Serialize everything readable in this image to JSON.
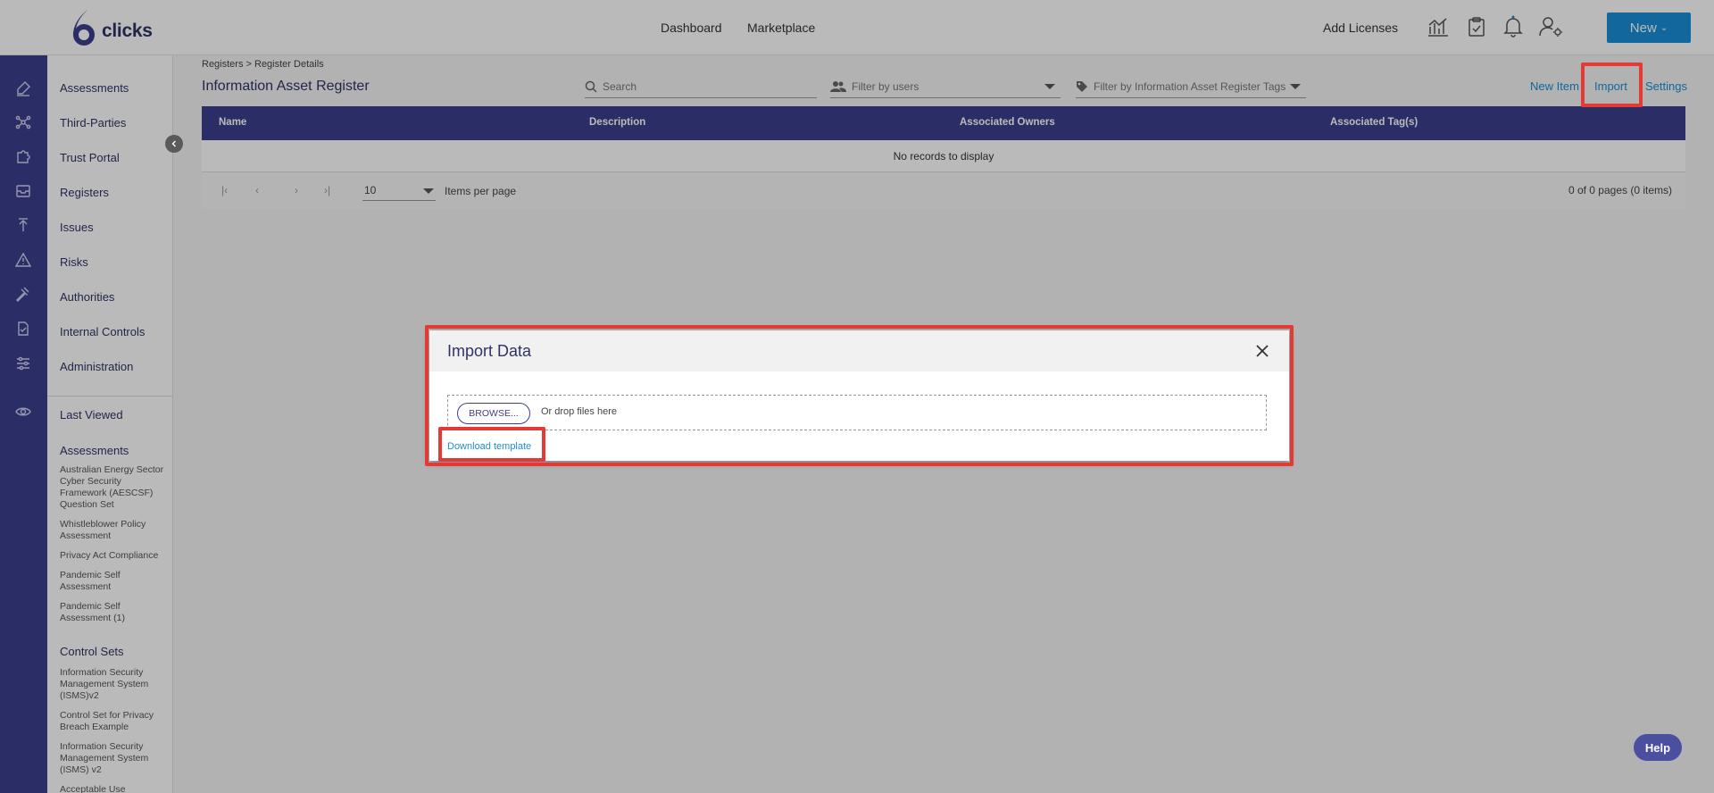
{
  "header": {
    "logo_text": "clicks",
    "nav": {
      "dashboard": "Dashboard",
      "marketplace": "Marketplace"
    },
    "add_licenses": "Add Licenses",
    "new_button": "New",
    "icons": [
      "analytics-icon",
      "clipboard-check-icon",
      "bell-icon",
      "user-settings-icon"
    ]
  },
  "sidebar": {
    "items": [
      {
        "label": "Assessments",
        "icon": "edit-icon"
      },
      {
        "label": "Third-Parties",
        "icon": "network-icon"
      },
      {
        "label": "Trust Portal",
        "icon": "puzzle-icon"
      },
      {
        "label": "Registers",
        "icon": "inbox-icon"
      },
      {
        "label": "Issues",
        "icon": "exit-icon"
      },
      {
        "label": "Risks",
        "icon": "warning-icon"
      },
      {
        "label": "Authorities",
        "icon": "gavel-icon"
      },
      {
        "label": "Internal Controls",
        "icon": "document-icon"
      },
      {
        "label": "Administration",
        "icon": "sliders-icon"
      }
    ],
    "last_viewed": {
      "label": "Last Viewed",
      "icon": "eye-icon",
      "assessments_title": "Assessments",
      "assessments": [
        "Australian Energy Sector Cyber Security Framework (AESCSF) Question Set",
        "Whistleblower Policy Assessment",
        "Privacy Act Compliance",
        "Pandemic Self Assessment",
        "Pandemic Self Assessment (1)"
      ],
      "control_sets_title": "Control Sets",
      "control_sets": [
        "Information Security Management System (ISMS)v2",
        "Control Set for Privacy Breach Example",
        "Information Security Management System (ISMS) v2",
        "Acceptable Use"
      ]
    }
  },
  "main": {
    "breadcrumb": "Registers >  Register Details",
    "title": "Information Asset Register",
    "search_placeholder": "Search",
    "filter_users": "Filter by users",
    "filter_tags": "Filter by Information Asset Register  Tags",
    "actions": {
      "new_item": "New Item",
      "import": "Import",
      "settings": "Settings"
    },
    "grid": {
      "columns": [
        "Name",
        "Description",
        "Associated Owners",
        "Associated Tag(s)"
      ],
      "empty": "No records to display",
      "page_size": "10",
      "items_per_page": "Items per page",
      "summary": "0 of 0 pages (0 items)"
    }
  },
  "modal": {
    "title": "Import Data",
    "browse": "BROWSE...",
    "drop_text": "Or drop files here",
    "download_template": "Download template"
  },
  "help": "Help",
  "colors": {
    "primary": "#3b3f8c",
    "accent": "#1a8fd6",
    "highlight": "#e53935"
  }
}
